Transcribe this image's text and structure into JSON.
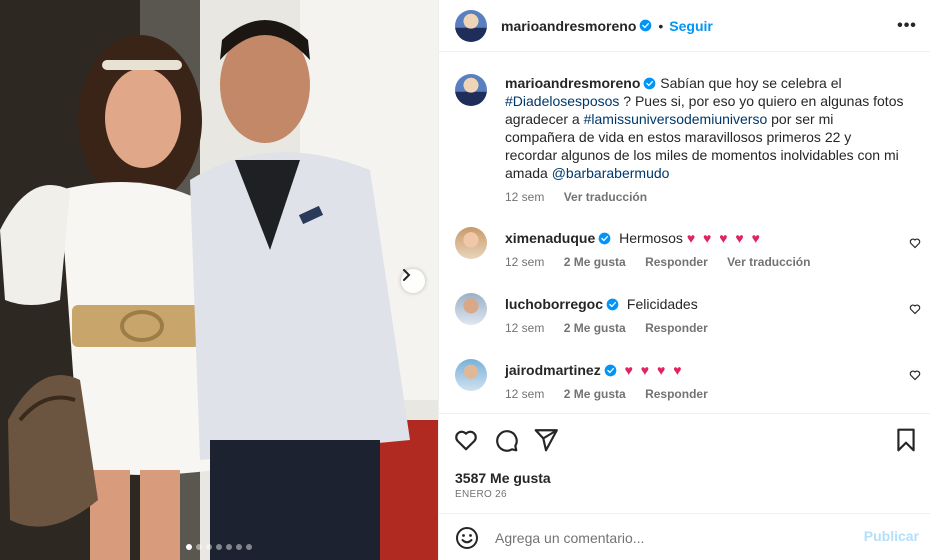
{
  "post": {
    "author": "marioandresmoreno",
    "follow_label": "Seguir",
    "separator": "•",
    "more_label": "•••",
    "image_count": 7,
    "active_image": 1
  },
  "caption": {
    "author": "marioandresmoreno",
    "text_1": "Sabían que hoy se celebra el",
    "hashtag_1": "#Diadelosesposos",
    "text_2": "? Pues si, por eso yo quiero en algunas fotos agradecer a",
    "hashtag_2": "#lamissuniversodemiuniverso",
    "text_3": "por ser mi compañera de vida en estos maravillosos primeros 22 y recordar algunos de los miles de momentos inolvidables con mi amada",
    "mention": "@barbarabermudo",
    "time": "12 sem",
    "translate": "Ver traducción"
  },
  "comments": [
    {
      "user": "ximenaduque",
      "text": "Hermosos",
      "hearts": "♥ ♥ ♥ ♥ ♥",
      "time": "12 sem",
      "likes": "2 Me gusta",
      "reply": "Responder",
      "translate": "Ver traducción"
    },
    {
      "user": "luchoborregoc",
      "text": "Felicidades",
      "hearts": "",
      "time": "12 sem",
      "likes": "2 Me gusta",
      "reply": "Responder"
    },
    {
      "user": "jairodmartinez",
      "text": "",
      "hearts": "♥ ♥ ♥ ♥",
      "time": "12 sem",
      "likes": "2 Me gusta",
      "reply": "Responder"
    }
  ],
  "stats": {
    "likes": "3587 Me gusta",
    "date": "ENERO 26"
  },
  "composer": {
    "placeholder": "Agrega un comentario...",
    "publish": "Publicar"
  },
  "colors": {
    "accent": "#0095f6",
    "verified": "#0095f6",
    "heart": "#e0245e",
    "publish_disabled": "#b2dffc"
  },
  "icons": {
    "like": "heart-icon",
    "comment": "comment-icon",
    "share": "send-icon",
    "save": "bookmark-icon",
    "emoji": "emoji-icon",
    "next": "chevron-right-icon"
  }
}
